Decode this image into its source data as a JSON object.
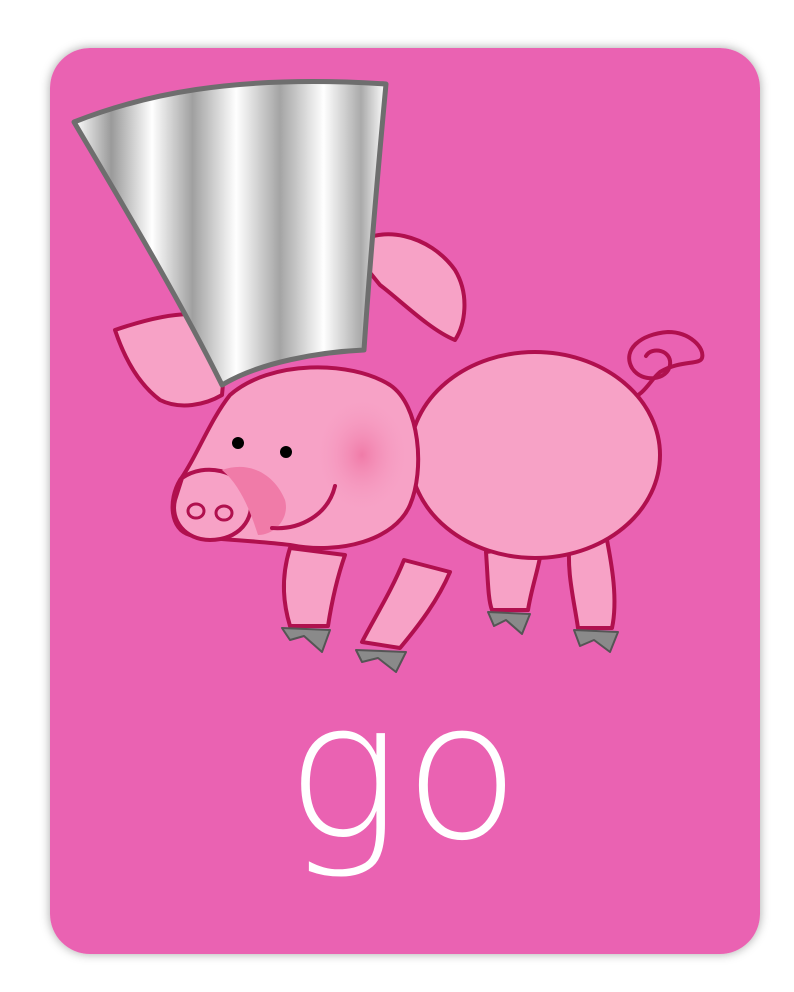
{
  "card": {
    "word": "go",
    "background_color": "#EA62B2",
    "word_color": "#FFFFFF"
  },
  "illustration": {
    "subject": "pig-with-chef-hat",
    "body_color": "#F7A2C6",
    "outline_color": "#B0104E",
    "hat_color": "#E6E6E6",
    "hoof_color": "#8A8A8A"
  }
}
